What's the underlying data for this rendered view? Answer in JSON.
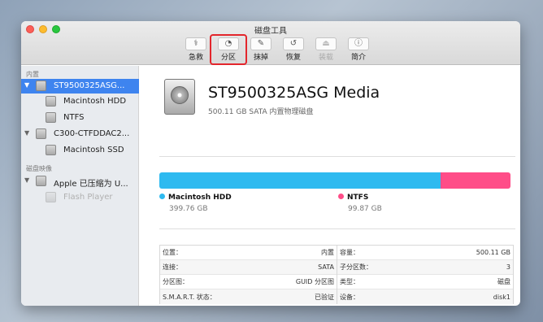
{
  "window": {
    "title": "磁盘工具"
  },
  "toolbar": [
    {
      "label": "急救",
      "icon": "stethoscope-icon",
      "glyph": "⚕",
      "disabled": false
    },
    {
      "label": "分区",
      "icon": "partition-pie-icon",
      "glyph": "◔",
      "disabled": false
    },
    {
      "label": "抹掉",
      "icon": "erase-icon",
      "glyph": "✎",
      "disabled": false
    },
    {
      "label": "恢复",
      "icon": "restore-icon",
      "glyph": "↺",
      "disabled": false
    },
    {
      "label": "装载",
      "icon": "mount-icon",
      "glyph": "⏏",
      "disabled": true
    },
    {
      "label": "简介",
      "icon": "info-icon",
      "glyph": "ⓘ",
      "disabled": false
    }
  ],
  "sidebar": {
    "internal_header": "内置",
    "image_header": "磁盘映像",
    "items": [
      {
        "label": "ST9500325ASG...",
        "level": 0,
        "expanded": true,
        "selected": true
      },
      {
        "label": "Macintosh HDD",
        "level": 1
      },
      {
        "label": "NTFS",
        "level": 1
      },
      {
        "label": "C300-CTFDDAC2...",
        "level": 0,
        "expanded": true
      },
      {
        "label": "Macintosh SSD",
        "level": 1
      },
      {
        "label": "Apple 已压缩为 U...",
        "level": 0,
        "expanded": true
      },
      {
        "label": "Flash Player",
        "level": 1,
        "dim": true
      }
    ]
  },
  "drive": {
    "name": "ST9500325ASG Media",
    "subtitle": "500.11 GB SATA 内置物理磁盘"
  },
  "partitions": [
    {
      "name": "Macintosh HDD",
      "size": "399.76 GB",
      "color": "#2ebaf0",
      "fraction": 0.8
    },
    {
      "name": "NTFS",
      "size": "99.87 GB",
      "color": "#ff4d88",
      "fraction": 0.2
    }
  ],
  "info": {
    "left": [
      {
        "label": "位置：",
        "value": "内置"
      },
      {
        "label": "连接：",
        "value": "SATA"
      },
      {
        "label": "分区图：",
        "value": "GUID 分区图"
      },
      {
        "label": "S.M.A.R.T. 状态：",
        "value": "已验证"
      }
    ],
    "right": [
      {
        "label": "容量：",
        "value": "500.11 GB"
      },
      {
        "label": "子分区数：",
        "value": "3"
      },
      {
        "label": "类型：",
        "value": "磁盘"
      },
      {
        "label": "设备：",
        "value": "disk1"
      }
    ]
  }
}
